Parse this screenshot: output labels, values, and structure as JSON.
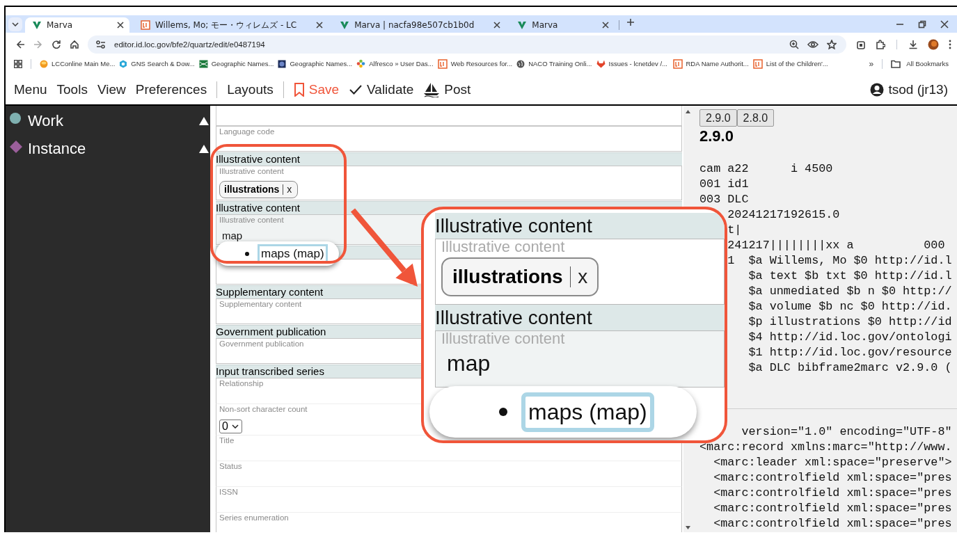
{
  "browser": {
    "tabs": [
      {
        "kind": "marva",
        "title": "Marva",
        "selected": true
      },
      {
        "kind": "loc",
        "title": "Willems, Mo; モー・ウィレムズ - LC",
        "selected": false
      },
      {
        "kind": "marva",
        "title": "Marva | nacfa98e507cb1b0d",
        "selected": false
      },
      {
        "kind": "marva",
        "title": "Marva",
        "selected": false
      }
    ],
    "address": "editor.id.loc.gov/bfe2/quartz/edit/e0487194",
    "bookmarks": [
      {
        "kind": "orb",
        "title": "LCConline Main Me..."
      },
      {
        "kind": "hexagon",
        "title": "GNS Search & Dow..."
      },
      {
        "kind": "map",
        "title": "Geographic Names..."
      },
      {
        "kind": "globe-dark",
        "title": "Geographic Names..."
      },
      {
        "kind": "flower",
        "title": "Alfresco » User Das..."
      },
      {
        "kind": "loc",
        "title": "Web Resources for..."
      },
      {
        "kind": "globe",
        "title": "NACO Training Onli..."
      },
      {
        "kind": "fox",
        "title": "Issues - lcnetdev /..."
      },
      {
        "kind": "loc",
        "title": "RDA Name Authorit..."
      },
      {
        "kind": "loc",
        "title": "List of the Children'..."
      }
    ],
    "overflow": "»",
    "all_bookmarks": "All Bookmarks"
  },
  "app_bar": {
    "menus": [
      "Menu",
      "Tools",
      "View",
      "Preferences"
    ],
    "layouts": "Layouts",
    "actions": [
      {
        "kind": "save",
        "label": "Save"
      },
      {
        "kind": "validate",
        "label": "Validate"
      },
      {
        "kind": "post",
        "label": "Post"
      }
    ],
    "user": "tsod (jr13)"
  },
  "sidebar": {
    "items": [
      {
        "label": "Work",
        "kind": "circle",
        "color": "#7fb0b0",
        "expanded": true
      },
      {
        "label": "Instance",
        "kind": "diamond",
        "color": "#9b5f9b",
        "expanded": true
      }
    ]
  },
  "form": {
    "sections": [
      {
        "kind": "plain",
        "fields": [
          {
            "kind": "text",
            "label": "Language code"
          }
        ]
      },
      {
        "kind": "section",
        "title": "Illustrative content",
        "fields": [
          {
            "kind": "chips",
            "label": "Illustrative content",
            "chips": [
              {
                "text": "illustrations",
                "remove": "x"
              }
            ]
          }
        ]
      },
      {
        "kind": "section",
        "title": "Illustrative content",
        "fields": [
          {
            "kind": "text",
            "label": "Illustrative content",
            "value": "map",
            "focused": true,
            "suggestions": [
              {
                "text": "maps (map)",
                "selected": true
              }
            ]
          }
        ]
      },
      {
        "kind": "section",
        "fields": [
          {
            "kind": "text"
          }
        ]
      },
      {
        "kind": "section",
        "title": "Supplementary content",
        "fields": [
          {
            "kind": "text",
            "label": "Supplementary content"
          }
        ]
      },
      {
        "kind": "section",
        "title": "Government publication",
        "fields": [
          {
            "kind": "text",
            "label": "Government publication"
          }
        ]
      },
      {
        "kind": "section",
        "title": "Input transcribed series",
        "fields": [
          {
            "kind": "text",
            "label": "Relationship"
          },
          {
            "kind": "select",
            "label": "Non-sort character count",
            "value": "0"
          },
          {
            "kind": "text",
            "label": "Title"
          },
          {
            "kind": "text",
            "label": "Status"
          },
          {
            "kind": "text",
            "label": "ISSN"
          },
          {
            "kind": "text",
            "label": "Series enumeration"
          }
        ]
      }
    ]
  },
  "marc": {
    "versions": [
      "2.9.0",
      "2.8.0"
    ],
    "heading": "2.9.0",
    "lines": [
      "cam a22      i 4500",
      "001 id1",
      "003 DLC",
      "    20241217192615.0",
      "    t|",
      "    241217||||||||xx a          000",
      "    1  $a Willems, Mo $0 http://id.l",
      "       $a text $b txt $0 http://id.l",
      "       $a unmediated $b n $0 http://",
      "       $a volume $b nc $0 http://id.",
      "       $p illustrations $0 http://id",
      "       $4 http://id.loc.gov/ontologi",
      "       $1 http://id.loc.gov/resource",
      "       $a DLC bibframe2marc v2.9.0 ("
    ],
    "xml_lines": [
      "      version=\"1.0\" encoding=\"UTF-8\"",
      "<marc:record xmlns:marc=\"http://www.",
      "  <marc:leader xml:space=\"preserve\">",
      "  <marc:controlfield xml:space=\"pres",
      "  <marc:controlfield xml:space=\"pres",
      "  <marc:controlfield xml:space=\"pres",
      "  <marc:controlfield xml:space=\"pres"
    ]
  },
  "callout": {
    "sections": [
      {
        "title": "Illustrative content",
        "label": "Illustrative content",
        "chip": "illustrations",
        "remove": "x"
      },
      {
        "title": "Illustrative content",
        "label": "Illustrative content",
        "value": "map"
      }
    ],
    "suggestion": {
      "text": "maps (map)",
      "selected": true
    }
  }
}
